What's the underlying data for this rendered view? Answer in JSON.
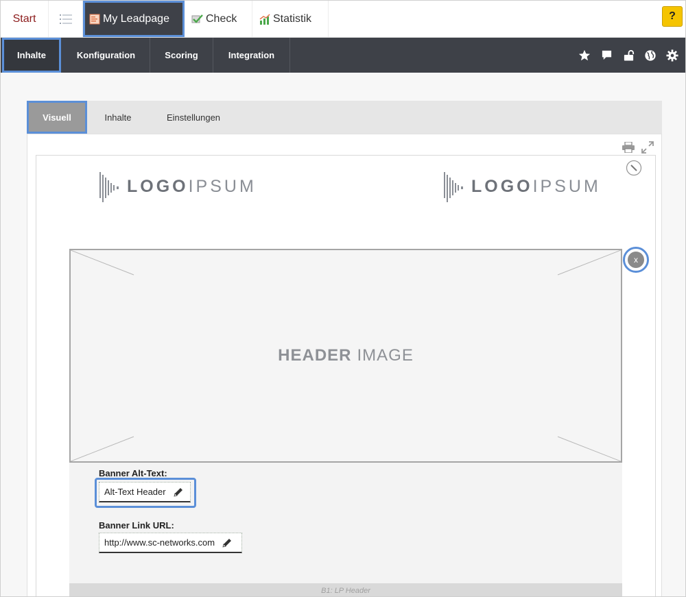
{
  "topnav": {
    "start": "Start",
    "leadpage": "My Leadpage",
    "check": "Check",
    "statistik": "Statistik",
    "help": "?"
  },
  "subnav": {
    "tabs": [
      "Inhalte",
      "Konfiguration",
      "Scoring",
      "Integration"
    ],
    "icons": [
      "star-icon",
      "comment-icon",
      "unlock-icon",
      "globe-icon",
      "gear-icon"
    ]
  },
  "panel": {
    "tabs": [
      "Visuell",
      "Inhalte",
      "Einstellungen"
    ]
  },
  "canvas": {
    "logo_bold": "LOGO",
    "logo_light": "IPSUM",
    "header_bold": "HEADER",
    "header_light": "IMAGE",
    "close": "x",
    "alt_label": "Banner Alt-Text:",
    "alt_value": "Alt-Text Header",
    "url_label": "Banner Link URL:",
    "url_value": "http://www.sc-networks.com",
    "footer": "B1: LP Header"
  },
  "colors": {
    "nav_dark": "#3e4148",
    "highlight": "#5b8fd8",
    "help": "#f5c400",
    "start": "#8b1a1a"
  }
}
